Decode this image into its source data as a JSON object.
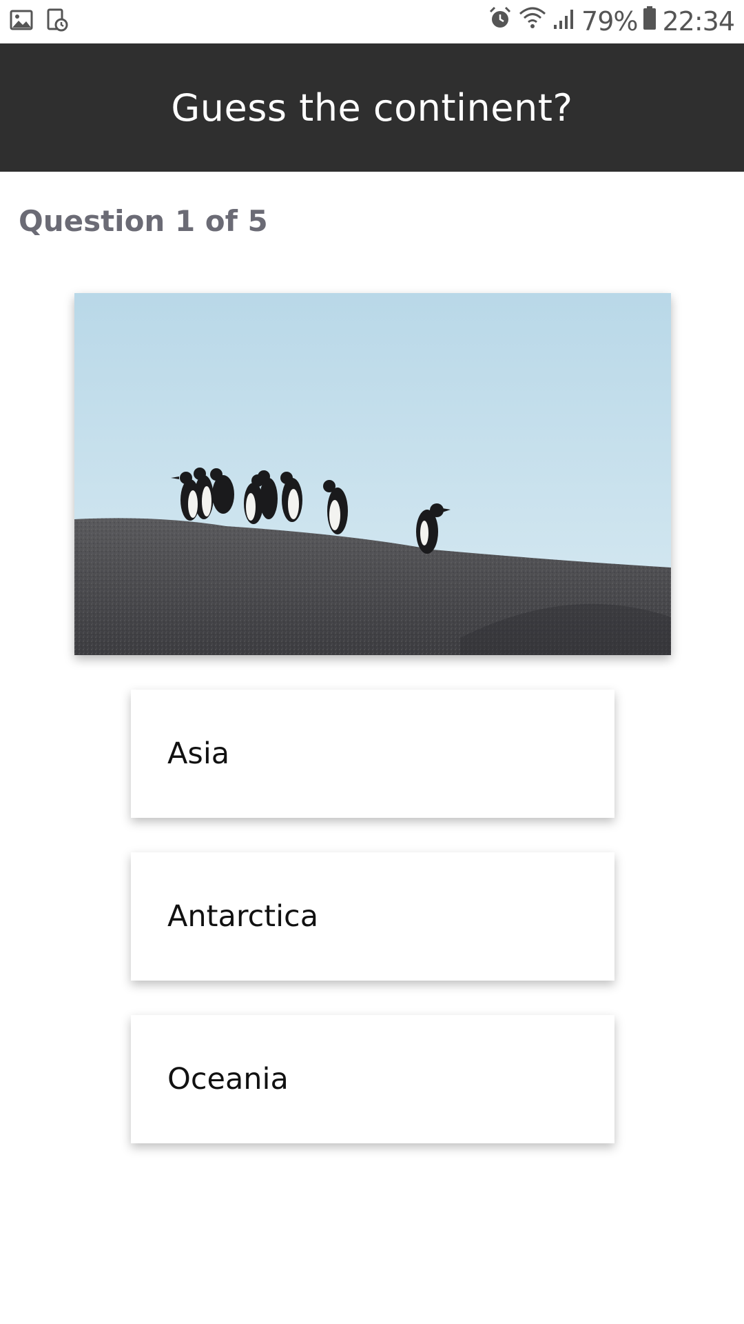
{
  "status_bar": {
    "battery": "79%",
    "time": "22:34",
    "icons": [
      "gallery-icon",
      "screenshot-icon",
      "alarm-icon",
      "wifi-icon",
      "signal-icon",
      "battery-icon"
    ]
  },
  "header": {
    "title": "Guess the continent?",
    "background_color": "#2f2f2f"
  },
  "quiz": {
    "counter": "Question 1 of 5",
    "image": "penguins-on-rock",
    "answers": [
      {
        "label": "Asia"
      },
      {
        "label": "Antarctica"
      },
      {
        "label": "Oceania"
      }
    ]
  }
}
